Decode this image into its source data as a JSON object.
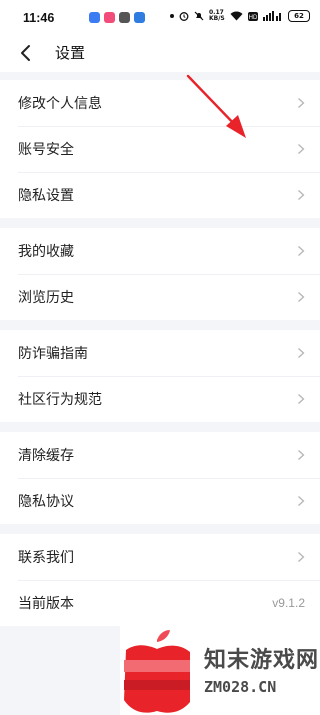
{
  "status_bar": {
    "time": "11:46",
    "network_speed": "0.17 KB/S",
    "battery": "62",
    "icons": [
      "app-icon",
      "app-icon",
      "app-icon",
      "app-icon",
      "app-icon",
      "alarm-icon",
      "mute-icon",
      "wifi-icon",
      "hd-icon",
      "signal-icon",
      "battery-icon"
    ]
  },
  "header": {
    "title": "设置",
    "back_icon": "chevron-left-icon"
  },
  "groups": [
    {
      "items": [
        {
          "label": "修改个人信息"
        },
        {
          "label": "账号安全"
        },
        {
          "label": "隐私设置"
        }
      ]
    },
    {
      "items": [
        {
          "label": "我的收藏"
        },
        {
          "label": "浏览历史"
        }
      ]
    },
    {
      "items": [
        {
          "label": "防诈骗指南"
        },
        {
          "label": "社区行为规范"
        }
      ]
    },
    {
      "items": [
        {
          "label": "清除缓存"
        },
        {
          "label": "隐私协议"
        }
      ]
    },
    {
      "items": [
        {
          "label": "联系我们"
        },
        {
          "label": "当前版本",
          "value": "v9.1.2"
        }
      ]
    }
  ],
  "watermark": {
    "line1": "知末游戏网",
    "line2": "ZM028.CN"
  },
  "colors": {
    "accent_arrow": "#e8242a",
    "background": "#f4f5f8"
  }
}
